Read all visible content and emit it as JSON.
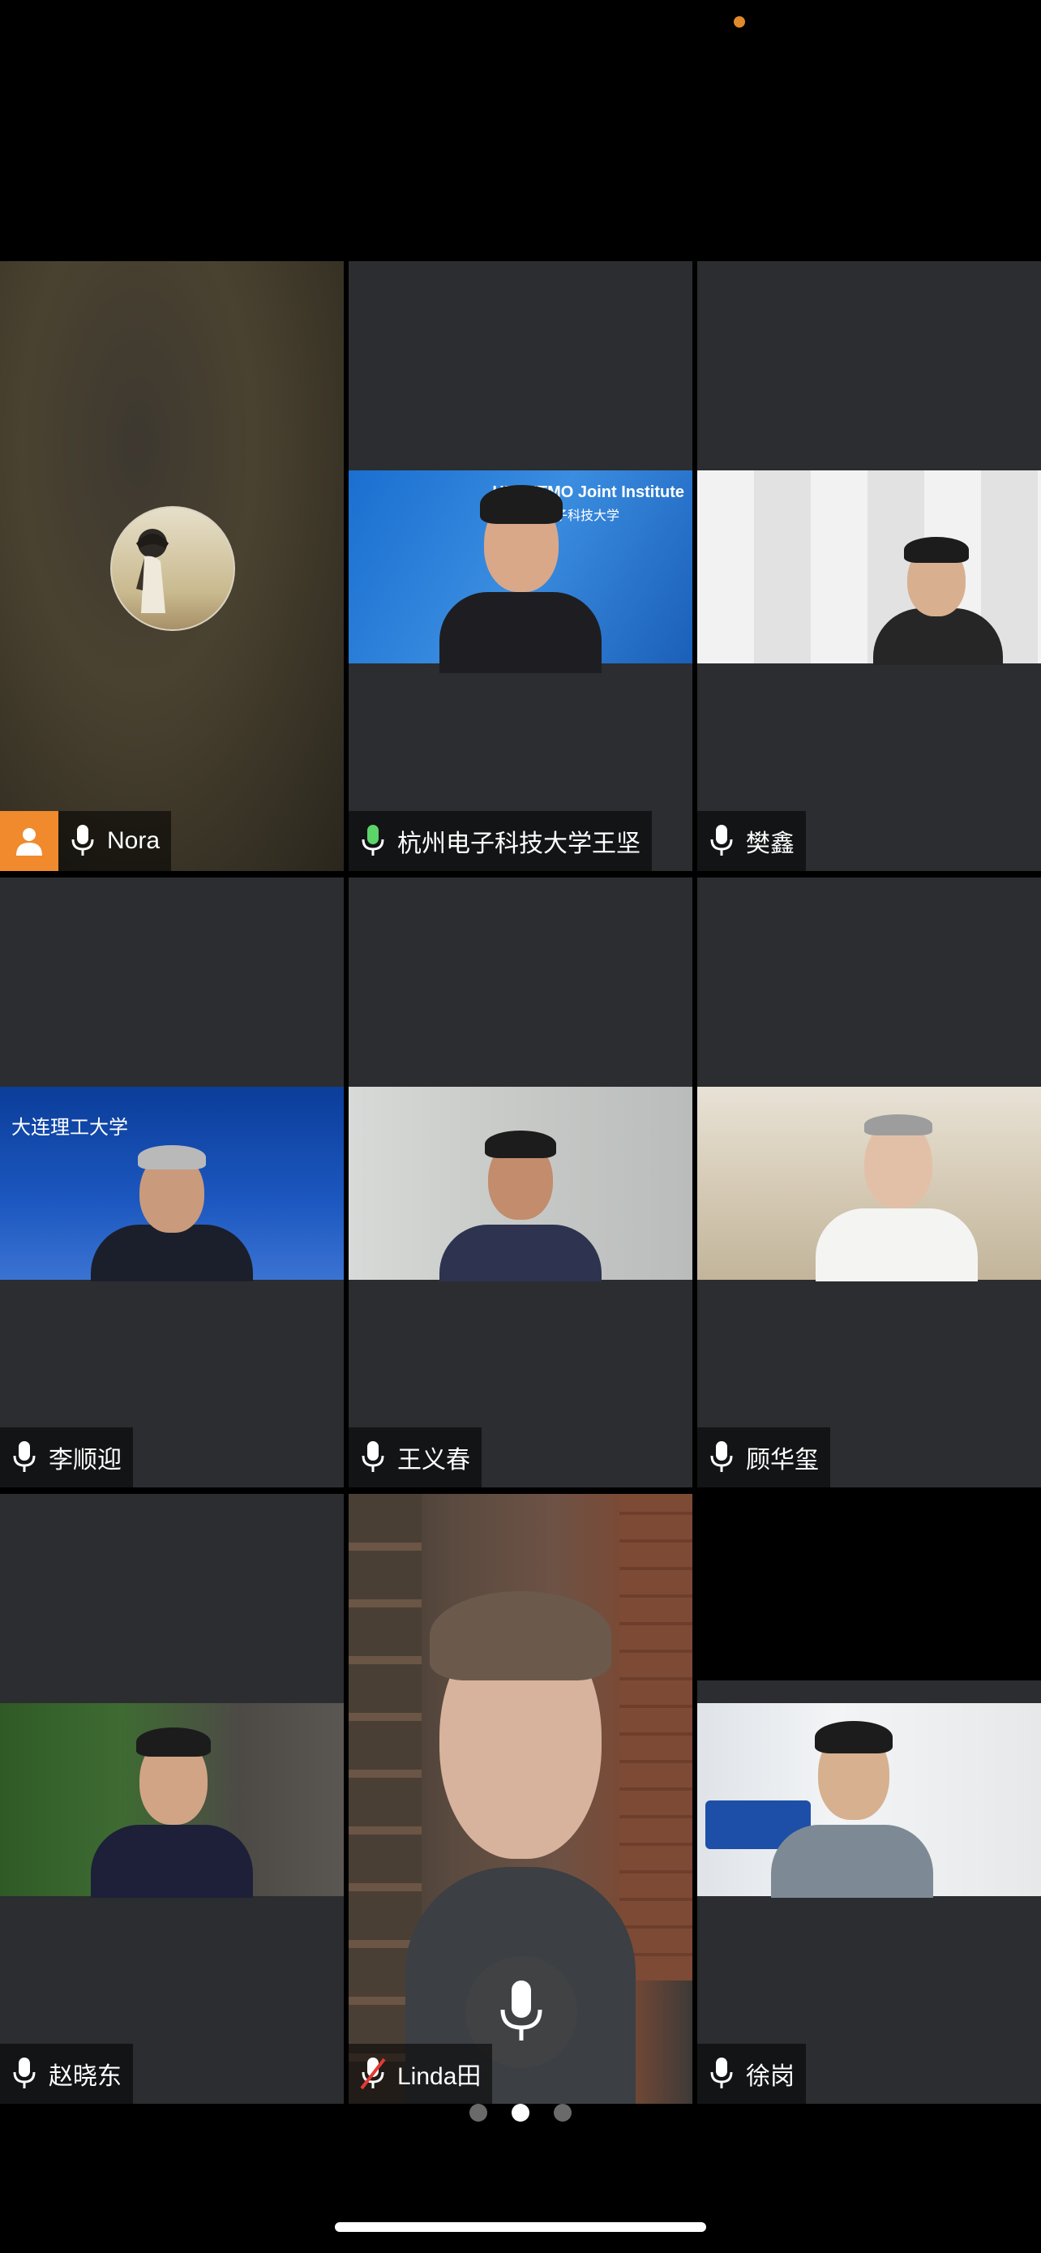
{
  "participants": [
    {
      "name": "Nora",
      "muted": false,
      "has_avatar_chip": true
    },
    {
      "name": "杭州电子科技大学王坚",
      "muted": false,
      "speaking": true
    },
    {
      "name": "樊鑫",
      "muted": false
    },
    {
      "name": "李顺迎",
      "muted": false
    },
    {
      "name": "王义春",
      "muted": false
    },
    {
      "name": "顾华玺",
      "muted": false
    },
    {
      "name": "赵晓东",
      "muted": false
    },
    {
      "name": "Linda田",
      "muted": true
    },
    {
      "name": "徐岗",
      "muted": false
    }
  ],
  "backgrounds": {
    "hdu_banner": "HDU-ITMO Joint Institute",
    "hdu_banner_cn": "子科技大学",
    "dalian_banner": "大连理工大学"
  },
  "pager": {
    "pages": 3,
    "current": 2
  },
  "colors": {
    "active_speaker_border": "#5bbf5a",
    "avatar_chip": "#f08a2c",
    "tile_bg": "#2b2d30",
    "status_dot": "#e08a2a"
  },
  "icons": [
    "mic-icon",
    "mic-muted-icon",
    "person-icon",
    "large-mic-icon"
  ]
}
